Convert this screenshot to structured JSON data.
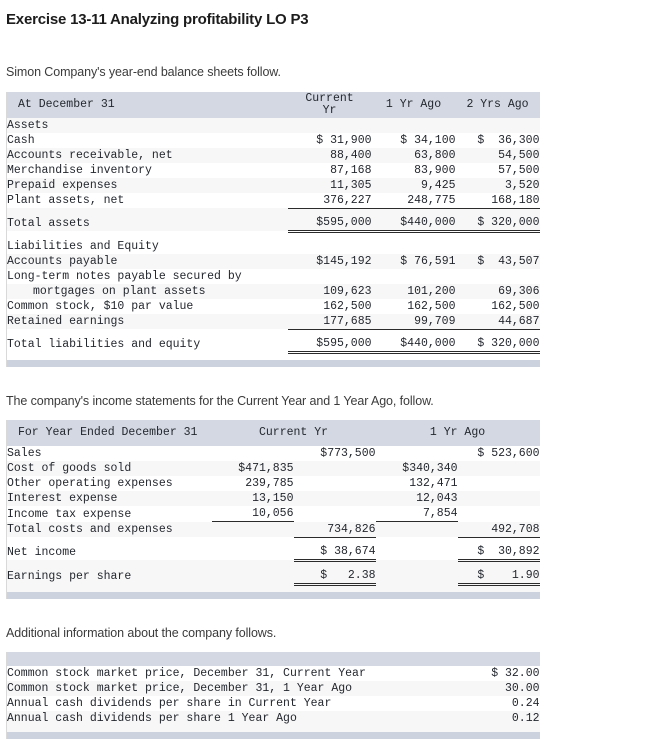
{
  "title": "Exercise 13-11 Analyzing profitability LO P3",
  "intro": {
    "balance_sheets": "Simon Company's year-end balance sheets follow.",
    "income_statements": "The company's income statements for the Current Year and 1 Year Ago, follow.",
    "additional_info": "Additional information about the company follows."
  },
  "balance_sheet": {
    "headers": {
      "label": "At December 31",
      "col1": "Current\nYr",
      "col2": "1 Yr Ago",
      "col3": "2 Yrs Ago"
    },
    "sections": [
      {
        "heading": "Assets",
        "rows": [
          {
            "label": "Cash",
            "c1": "$ 31,900",
            "c2": "$ 34,100",
            "c3": "$  36,300"
          },
          {
            "label": "Accounts receivable, net",
            "c1": "88,400",
            "c2": "63,800",
            "c3": "54,500"
          },
          {
            "label": "Merchandise inventory",
            "c1": "87,168",
            "c2": "83,900",
            "c3": "57,500"
          },
          {
            "label": "Prepaid expenses",
            "c1": "11,305",
            "c2": "9,425",
            "c3": "3,520"
          },
          {
            "label": "Plant assets, net",
            "c1": "376,227",
            "c2": "248,775",
            "c3": "168,180"
          }
        ],
        "total": {
          "label": "Total assets",
          "c1": "$595,000",
          "c2": "$440,000",
          "c3": "$ 320,000"
        }
      },
      {
        "heading": "Liabilities and Equity",
        "rows": [
          {
            "label": "Accounts payable",
            "c1": "$145,192",
            "c2": "$ 76,591",
            "c3": "$  43,507"
          },
          {
            "label": "Long-term notes payable secured by",
            "c1": "",
            "c2": "",
            "c3": ""
          },
          {
            "label": "mortgages on plant assets",
            "indent": true,
            "c1": "109,623",
            "c2": "101,200",
            "c3": "69,306"
          },
          {
            "label": "Common stock, $10 par value",
            "c1": "162,500",
            "c2": "162,500",
            "c3": "162,500"
          },
          {
            "label": "Retained earnings",
            "c1": "177,685",
            "c2": "99,709",
            "c3": "44,687"
          }
        ],
        "total": {
          "label": "Total liabilities and equity",
          "c1": "$595,000",
          "c2": "$440,000",
          "c3": "$ 320,000"
        }
      }
    ]
  },
  "income_statement": {
    "headers": {
      "label": "For Year Ended December 31",
      "current": "Current Yr",
      "prior": "1 Yr Ago"
    },
    "rows": [
      {
        "label": "Sales",
        "cur_sub": "",
        "cur_main": "$773,500",
        "pri_sub": "",
        "pri_main": "$ 523,600"
      },
      {
        "label": "Cost of goods sold",
        "cur_sub": "$471,835",
        "cur_main": "",
        "pri_sub": "$340,340",
        "pri_main": ""
      },
      {
        "label": "Other operating expenses",
        "cur_sub": "239,785",
        "cur_main": "",
        "pri_sub": "132,471",
        "pri_main": ""
      },
      {
        "label": "Interest expense",
        "cur_sub": "13,150",
        "cur_main": "",
        "pri_sub": "12,043",
        "pri_main": ""
      },
      {
        "label": "Income tax expense",
        "cur_sub": "10,056",
        "cur_main": "",
        "pri_sub": "7,854",
        "pri_main": ""
      },
      {
        "label": "Total costs and expenses",
        "cur_sub": "",
        "cur_main": "734,826",
        "pri_sub": "",
        "pri_main": "492,708"
      },
      {
        "label": "Net income",
        "cur_sub": "",
        "cur_main": "$ 38,674",
        "pri_sub": "",
        "pri_main": "$  30,892"
      },
      {
        "label": "Earnings per share",
        "cur_sub": "",
        "cur_main": "$   2.38",
        "pri_sub": "",
        "pri_main": "$    1.90"
      }
    ]
  },
  "additional_info": {
    "rows": [
      {
        "label": "Common stock market price, December 31, Current Year",
        "value": "$ 32.00"
      },
      {
        "label": "Common stock market price, December 31, 1 Year Ago",
        "value": "30.00"
      },
      {
        "label": "Annual cash dividends per share in Current Year",
        "value": "0.24"
      },
      {
        "label": "Annual cash dividends per share 1 Year Ago",
        "value": "0.12"
      }
    ]
  },
  "colors": {
    "header_bg": "#d4d8e2",
    "footer_bg": "#ccd2de",
    "stripe": "#f7f7f7",
    "text": "#23272e"
  }
}
